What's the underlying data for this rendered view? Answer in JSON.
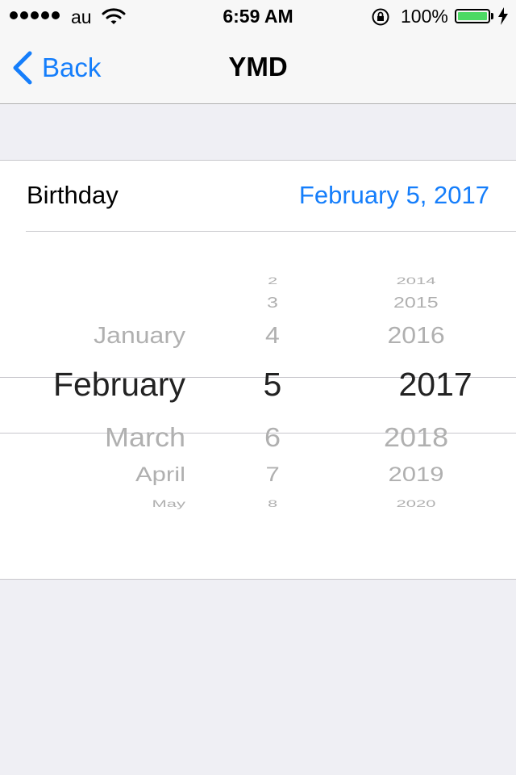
{
  "status_bar": {
    "carrier": "au",
    "time": "6:59 AM",
    "battery_percent": "100%",
    "battery_level": 1.0,
    "icons": [
      "signal-dots-icon",
      "wifi-icon",
      "orientation-lock-icon",
      "battery-icon",
      "charging-bolt-icon"
    ]
  },
  "nav": {
    "back_label": "Back",
    "title": "YMD"
  },
  "birthday": {
    "label": "Birthday",
    "value": "February 5, 2017"
  },
  "picker": {
    "months": [
      "January",
      "February",
      "March",
      "April",
      "May"
    ],
    "days": [
      "2",
      "3",
      "4",
      "5",
      "6",
      "7",
      "8"
    ],
    "years": [
      "2014",
      "2015",
      "2016",
      "2017",
      "2018",
      "2019",
      "2020"
    ],
    "selected_month": "February",
    "selected_day": "5",
    "selected_year": "2017"
  },
  "colors": {
    "accent": "#157efb",
    "background": "#efeff4",
    "battery_green": "#4cd964"
  }
}
